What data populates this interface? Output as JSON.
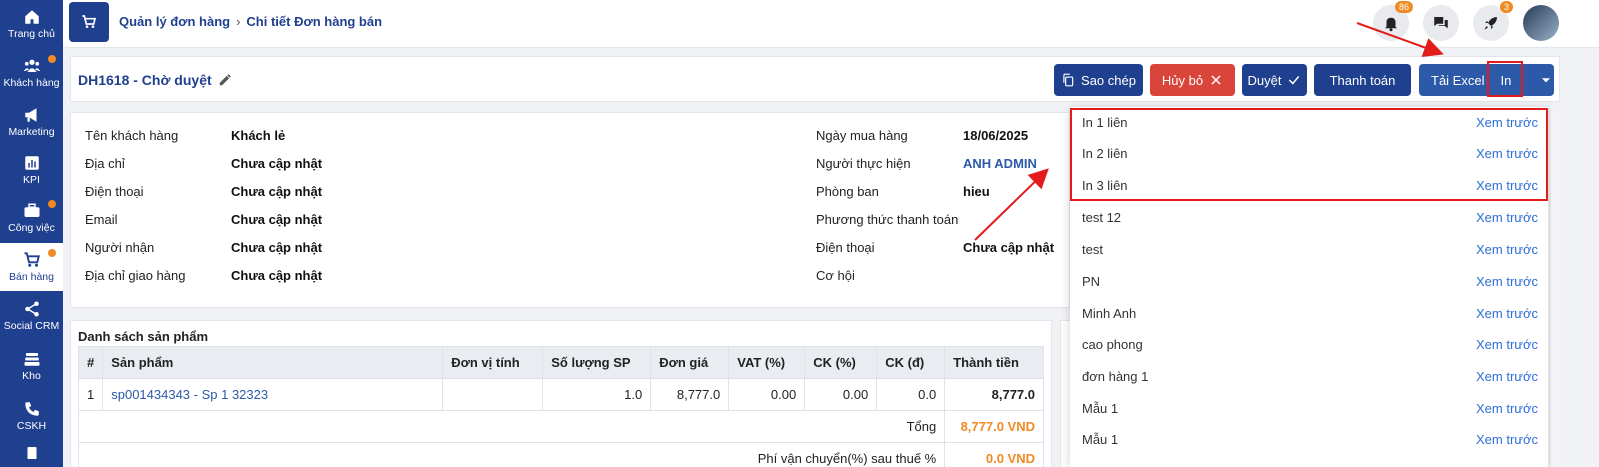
{
  "sidebar": {
    "items": [
      {
        "label": "Trang chủ",
        "icon": "home-icon",
        "dot": false
      },
      {
        "label": "Khách hàng",
        "icon": "users-icon",
        "dot": true
      },
      {
        "label": "Marketing",
        "icon": "megaphone-icon",
        "dot": false
      },
      {
        "label": "KPI",
        "icon": "chart-icon",
        "dot": false
      },
      {
        "label": "Công việc",
        "icon": "briefcase-icon",
        "dot": true
      },
      {
        "label": "Bán hàng",
        "icon": "cart-icon",
        "dot": true,
        "active": true
      },
      {
        "label": "Social CRM",
        "icon": "share-icon",
        "dot": false
      },
      {
        "label": "Kho",
        "icon": "warehouse-icon",
        "dot": false
      },
      {
        "label": "CSKH",
        "icon": "phone-icon",
        "dot": false
      }
    ]
  },
  "topbar": {
    "breadcrumb": [
      "Quản lý đơn hàng",
      "Chi tiết Đơn hàng bán"
    ],
    "notifications": "86",
    "rocket_badge": "3"
  },
  "header": {
    "title": "DH1618 - Chờ duyệt",
    "buttons": {
      "copy": "Sao chép",
      "cancel": "Hủy bỏ",
      "approve": "Duyệt",
      "pay": "Thanh toán",
      "excel": "Tải Excel",
      "print": "In"
    }
  },
  "info": {
    "left": [
      {
        "label": "Tên khách hàng",
        "value": "Khách lẻ"
      },
      {
        "label": "Địa chỉ",
        "value": "Chưa cập nhật"
      },
      {
        "label": "Điện thoại",
        "value": "Chưa cập nhật"
      },
      {
        "label": "Email",
        "value": "Chưa cập nhật"
      },
      {
        "label": "Người nhận",
        "value": "Chưa cập nhật"
      },
      {
        "label": "Địa chỉ giao hàng",
        "value": "Chưa cập nhật"
      }
    ],
    "right": [
      {
        "label": "Ngày mua hàng",
        "value": "18/06/2025"
      },
      {
        "label": "Người thực hiện",
        "value": "ANH ADMIN"
      },
      {
        "label": "Phòng ban",
        "value": "hieu"
      },
      {
        "label": "Phương thức thanh toán",
        "value": ""
      },
      {
        "label": "Điện thoại",
        "value": "Chưa cập nhật"
      },
      {
        "label": "Cơ hội",
        "value": ""
      }
    ]
  },
  "products": {
    "title": "Danh sách sản phẩm",
    "columns": [
      "#",
      "Sản phẩm",
      "Đơn vị tính",
      "Số lượng SP",
      "Đơn giá",
      "VAT (%)",
      "CK (%)",
      "CK (đ)",
      "Thành tiền"
    ],
    "rows": [
      {
        "idx": "1",
        "product": "sp001434343 - Sp 1 32323",
        "unit": "",
        "qty": "1.0",
        "price": "8,777.0",
        "vat": "0.00",
        "ck_pct": "0.00",
        "ck_amt": "0.0",
        "total": "8,777.0"
      }
    ],
    "total_label": "Tổng",
    "total_value": "8,777.0 VND",
    "shipping_label": "Phí vận chuyển(%) sau thuế %",
    "shipping_value": "0.0 VND"
  },
  "print_menu": {
    "preview_label": "Xem trước",
    "items": [
      "In 1 liên",
      "In 2 liên",
      "In 3 liên",
      "test 12",
      "test",
      "PN",
      "Minh Anh",
      "cao phong",
      "đơn hàng 1",
      "Mẫu 1",
      "Mẫu 1"
    ]
  }
}
